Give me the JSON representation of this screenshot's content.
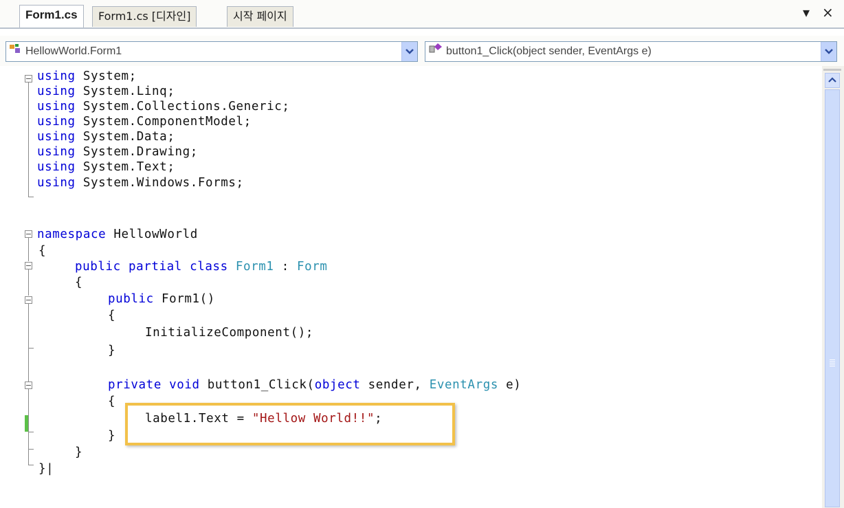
{
  "tabs": [
    {
      "label": "Form1.cs",
      "active": true
    },
    {
      "label": "Form1.cs [디자인]",
      "active": false
    },
    {
      "label": "시작 페이지",
      "active": false
    }
  ],
  "window_controls": {
    "dropdown": "▾",
    "close": "×"
  },
  "nav": {
    "class_selector": "HellowWorld.Form1",
    "member_selector": "button1_Click(object sender, EventArgs e)"
  },
  "code": {
    "lines": [
      [
        "using",
        " System;"
      ],
      [
        "using",
        " System.Linq;"
      ],
      [
        "using",
        " System.Collections.Generic;"
      ],
      [
        "using",
        " System.ComponentModel;"
      ],
      [
        "using",
        " System.Data;"
      ],
      [
        "using",
        " System.Drawing;"
      ],
      [
        "using",
        " System.Text;"
      ],
      [
        "using",
        " System.Windows.Forms;"
      ]
    ],
    "namespace_kw": "namespace",
    "namespace_name": " HellowWorld",
    "open_brace": "{",
    "close_brace": "}",
    "class_public": "public",
    "class_partial": "partial",
    "class_kw": "class",
    "class_name": "Form1",
    "class_colon": " : ",
    "class_base": "Form",
    "ctor_public": "public",
    "ctor_name": " Form1()",
    "init_call": "InitializeComponent();",
    "method_private": "private",
    "method_void": "void",
    "method_sig1": " button1_Click(",
    "method_object": "object",
    "method_sig2": " sender, ",
    "method_eventargs": "EventArgs",
    "method_sig3": " e)",
    "assign_lhs": "label1.Text = ",
    "assign_str": "\"Hellow World!!\"",
    "assign_end": ";",
    "ns_close": "}|"
  },
  "colors": {
    "keyword": "#0000d8",
    "type": "#2b91af",
    "string": "#a31515",
    "highlight_border": "#f2c14a",
    "changed_line_marker": "#5cc148"
  }
}
